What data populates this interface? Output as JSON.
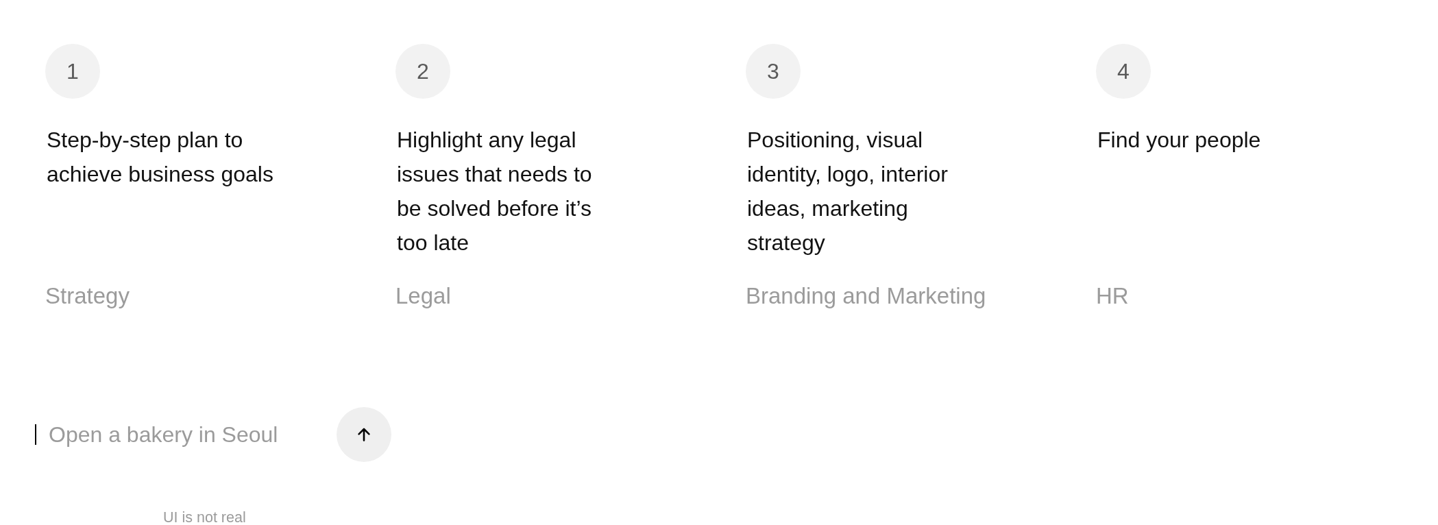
{
  "steps": [
    {
      "number": "1",
      "description": "Step-by-step plan to\nachieve business goals",
      "category": "Strategy"
    },
    {
      "number": "2",
      "description": "Highlight any legal\nissues that needs to\nbe solved before it’s\ntoo late",
      "category": "Legal"
    },
    {
      "number": "3",
      "description": "Positioning, visual\nidentity, logo, interior\nideas, marketing\nstrategy",
      "category": "Branding and Marketing"
    },
    {
      "number": "4",
      "description": "Find your people",
      "category": "HR"
    }
  ],
  "prompt": {
    "placeholder": "Open a bakery in Seoul",
    "focused": true
  },
  "footer_note": "UI is not real"
}
